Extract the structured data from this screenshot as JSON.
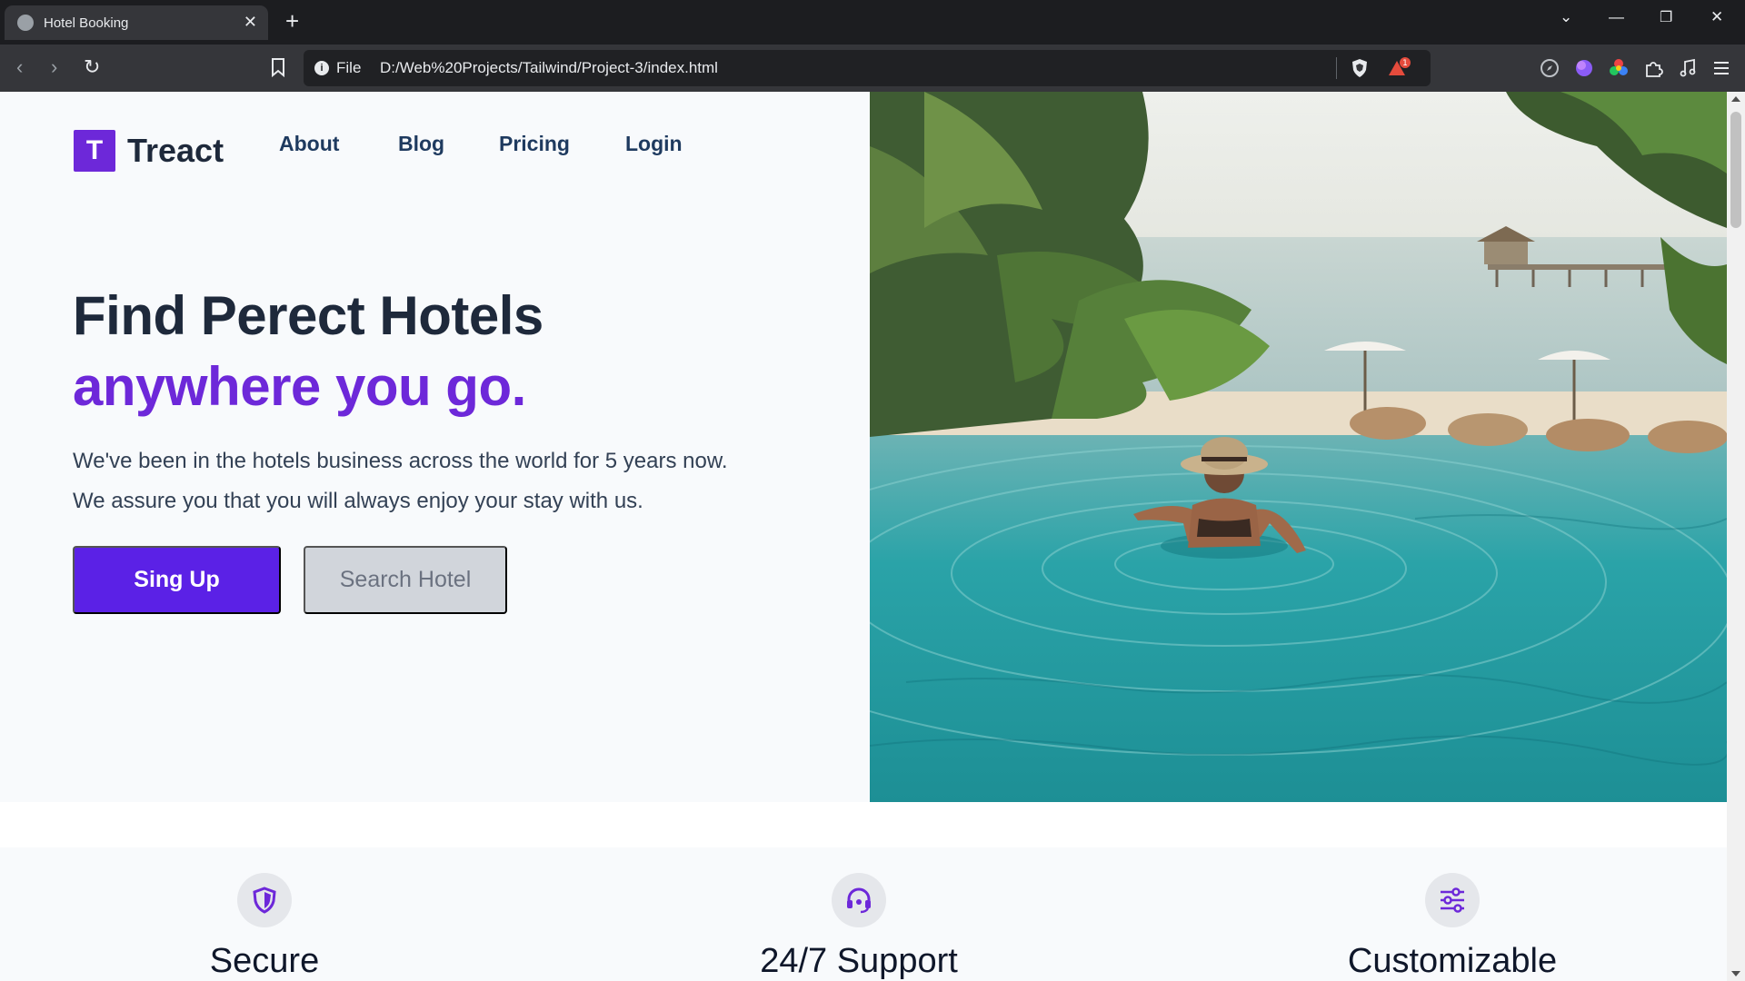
{
  "browser": {
    "tab_title": "Hotel Booking",
    "scheme_label": "File",
    "url": "D:/Web%20Projects/Tailwind/Project-3/index.html",
    "rewards_badge": "1"
  },
  "brand": {
    "mark": "T",
    "name": "Treact"
  },
  "nav": [
    "About",
    "Blog",
    "Pricing",
    "Login"
  ],
  "hero": {
    "heading_line1": "Find Perect Hotels",
    "heading_line2": "anywhere you go.",
    "lead_line1": "We've been in the hotels business across the world for 5 years now.",
    "lead_line2": "We assure you that you will always enjoy your stay with us.",
    "primary_cta": "Sing Up",
    "secondary_cta": "Search Hotel"
  },
  "features": [
    {
      "label": "Secure",
      "icon": "shield-icon"
    },
    {
      "label": "24/7 Support",
      "icon": "headset-icon"
    },
    {
      "label": "Customizable",
      "icon": "sliders-icon"
    }
  ],
  "colors": {
    "brand": "#6d28d9",
    "primary_button": "#5b21e6",
    "heading": "#1e293b"
  }
}
